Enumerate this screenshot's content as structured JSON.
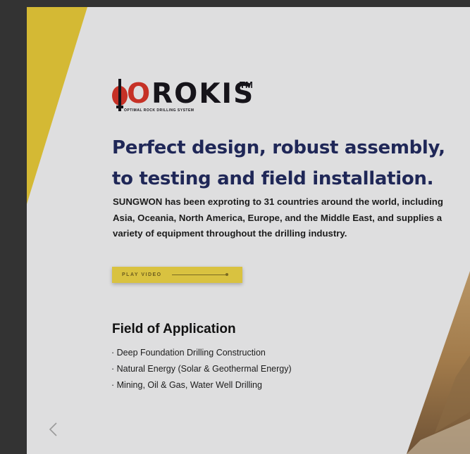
{
  "brand": {
    "logo_text_lead": "O",
    "logo_text_rest": "ROKIS",
    "logo_tm": "TM",
    "logo_subtitle": "OPTIMAL ROCK DRILLING SYSTEM"
  },
  "hero": {
    "headline_line1": "Perfect design, robust assembly,",
    "headline_line2": "to testing and field installation.",
    "description": "SUNGWON has been exproting to 31 countries around the world, including Asia, Oceania, North America, Europe, and the Middle East, and supplies a variety of equipment throughout the drilling industry."
  },
  "cta": {
    "play_label": "PLAY VIDEO"
  },
  "applications": {
    "title": "Field of Application",
    "items": [
      "· Deep Foundation Drilling Construction",
      "· Natural Energy (Solar & Geothermal Energy)",
      "· Mining, Oil & Gas, Water Well Drilling"
    ]
  },
  "icons": {
    "prev": "chevron-left-icon"
  },
  "colors": {
    "accent_yellow": "#d9c240",
    "headline_navy": "#1f2757",
    "logo_red": "#c63126",
    "panel_bg": "#dededf",
    "outer_bg": "#333333"
  }
}
